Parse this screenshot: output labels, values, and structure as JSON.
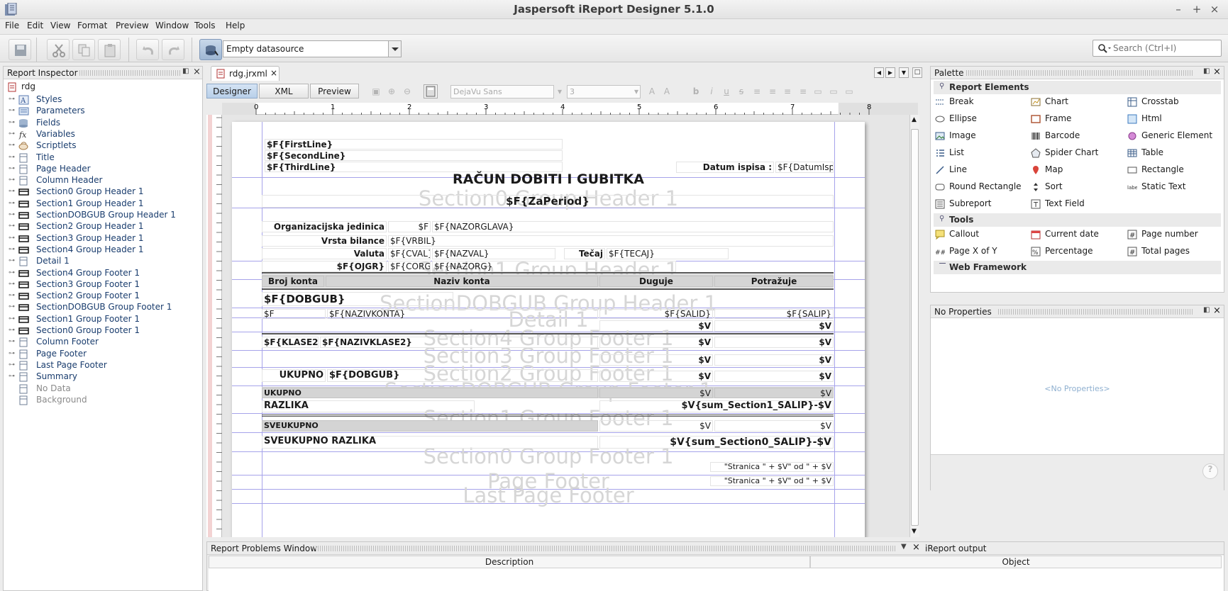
{
  "window": {
    "title": "Jaspersoft iReport Designer 5.1.0"
  },
  "menu": [
    "File",
    "Edit",
    "View",
    "Format",
    "Preview",
    "Window",
    "Tools",
    "Help"
  ],
  "toolbar": {
    "datasource": "Empty datasource",
    "search_placeholder": "Search (Ctrl+I)"
  },
  "inspector": {
    "title": "Report Inspector",
    "root": "rdg",
    "items": [
      {
        "label": "Styles",
        "icon": "styles-icon"
      },
      {
        "label": "Parameters",
        "icon": "parameters-icon"
      },
      {
        "label": "Fields",
        "icon": "fields-icon"
      },
      {
        "label": "Variables",
        "icon": "variables-icon"
      },
      {
        "label": "Scriptlets",
        "icon": "scriptlets-icon"
      },
      {
        "label": "Title",
        "icon": "band-icon"
      },
      {
        "label": "Page Header",
        "icon": "band-icon"
      },
      {
        "label": "Column Header",
        "icon": "band-icon"
      },
      {
        "label": "Section0 Group Header 1",
        "icon": "group-band-icon"
      },
      {
        "label": "Section1 Group Header 1",
        "icon": "group-band-icon"
      },
      {
        "label": "SectionDOBGUB Group Header 1",
        "icon": "group-band-icon"
      },
      {
        "label": "Section2 Group Header 1",
        "icon": "group-band-icon"
      },
      {
        "label": "Section3 Group Header 1",
        "icon": "group-band-icon"
      },
      {
        "label": "Section4 Group Header 1",
        "icon": "group-band-icon"
      },
      {
        "label": "Detail 1",
        "icon": "band-icon"
      },
      {
        "label": "Section4 Group Footer 1",
        "icon": "group-band-icon"
      },
      {
        "label": "Section3 Group Footer 1",
        "icon": "group-band-icon"
      },
      {
        "label": "Section2 Group Footer 1",
        "icon": "group-band-icon"
      },
      {
        "label": "SectionDOBGUB Group Footer 1",
        "icon": "group-band-icon"
      },
      {
        "label": "Section1 Group Footer 1",
        "icon": "group-band-icon"
      },
      {
        "label": "Section0 Group Footer 1",
        "icon": "group-band-icon"
      },
      {
        "label": "Column Footer",
        "icon": "band-icon"
      },
      {
        "label": "Page Footer",
        "icon": "band-icon"
      },
      {
        "label": "Last Page Footer",
        "icon": "band-icon"
      },
      {
        "label": "Summary",
        "icon": "band-icon"
      },
      {
        "label": "No Data",
        "icon": "band-icon",
        "dim": true
      },
      {
        "label": "Background",
        "icon": "band-icon",
        "dim": true
      }
    ]
  },
  "editor": {
    "tab": "rdg.jrxml",
    "modes": [
      "Designer",
      "XML",
      "Preview"
    ],
    "font_name": "DejaVu Sans",
    "font_size": "3",
    "ruler_numbers": [
      "0",
      "1",
      "2",
      "3",
      "4",
      "5",
      "6",
      "7",
      "8"
    ]
  },
  "report": {
    "first_line": "$F{FirstLine}",
    "second_line": "$F{SecondLine}",
    "third_line": "$F{ThirdLine}",
    "datum_label": "Datum ispisa :",
    "datum_value": "$F{DatumIsp}",
    "main_title": "RAČUN DOBITI I GUBITKA",
    "period": "$F{ZaPeriod}",
    "org_label": "Organizacijska jedinica",
    "org_f": "$F",
    "org_value": "$F{NAZORGLAVA}",
    "vrsta_label": "Vrsta bilance",
    "vrsta_value": "$F{VRBIL}",
    "valuta_label": "Valuta",
    "cval": "$F{CVAL}",
    "nazval": "$F{NAZVAL}",
    "tecaj_label": "Tečaj",
    "tecaj_value": "$F{TECAJ}",
    "ojgr": "$F{OJGR}",
    "corg": "$F{CORG}",
    "nazorg": "$F{NAZORG}",
    "col_broj": "Broj konta",
    "col_naziv": "Naziv konta",
    "col_duguje": "Duguje",
    "col_potrazuje": "Potražuje",
    "dobgub": "$F{DOBGUB}",
    "detail_f": "$F",
    "nazivkonta": "$F{NAZIVKONTA}",
    "salid": "$F{SALID}",
    "salip": "$F{SALIP}",
    "v": "$V",
    "klase2": "$F{KLASE2}",
    "nazivklase2": "$F{NAZIVKLASE2}",
    "ukupno": "UKUPNO",
    "razlika": "RAZLIKA",
    "razlika_expr": "$V{sum_Section1_SALIP}-$V",
    "sveukupno": "SVEUKUPNO",
    "sveukupno_razlika": "SVEUKUPNO RAZLIKA",
    "sveukupno_expr": "$V{sum_Section0_SALIP}-$V",
    "page_expr": "\"Stranica \" + $V\" od \" + $V",
    "bands": {
      "s0h": "Section0 Group Header 1",
      "s1h": "Section1 Group Header 1",
      "dobh": "SectionDOBGUB Group Header 1",
      "detail": "Detail 1",
      "s4f": "Section4 Group Footer 1",
      "s3f": "Section3 Group Footer 1",
      "s2f": "Section2 Group Footer 1",
      "dobf": "SectionDOBGUB Group Footer 1",
      "s1f": "Section1 Group Footer 1",
      "s0f": "Section0 Group Footer 1",
      "pf": "Page Footer",
      "lpf": "Last Page Footer"
    }
  },
  "palette": {
    "title": "Palette",
    "cat_report": "Report Elements",
    "report_elements": [
      {
        "label": "Break",
        "icon": "break-icon"
      },
      {
        "label": "Chart",
        "icon": "chart-icon"
      },
      {
        "label": "Crosstab",
        "icon": "crosstab-icon"
      },
      {
        "label": "Ellipse",
        "icon": "ellipse-icon"
      },
      {
        "label": "Frame",
        "icon": "frame-icon"
      },
      {
        "label": "Html",
        "icon": "html-icon"
      },
      {
        "label": "Image",
        "icon": "image-icon"
      },
      {
        "label": "Barcode",
        "icon": "barcode-icon"
      },
      {
        "label": "Generic Element",
        "icon": "generic-element-icon"
      },
      {
        "label": "List",
        "icon": "list-icon"
      },
      {
        "label": "Spider Chart",
        "icon": "spider-chart-icon"
      },
      {
        "label": "Table",
        "icon": "table-icon"
      },
      {
        "label": "Line",
        "icon": "line-icon"
      },
      {
        "label": "Map",
        "icon": "map-icon"
      },
      {
        "label": "Rectangle",
        "icon": "rectangle-icon"
      },
      {
        "label": "Round Rectangle",
        "icon": "round-rectangle-icon"
      },
      {
        "label": "Sort",
        "icon": "sort-icon"
      },
      {
        "label": "Static Text",
        "icon": "static-text-icon"
      },
      {
        "label": "Subreport",
        "icon": "subreport-icon"
      },
      {
        "label": "Text Field",
        "icon": "text-field-icon"
      }
    ],
    "cat_tools": "Tools",
    "tools": [
      {
        "label": "Callout",
        "icon": "callout-icon"
      },
      {
        "label": "Current date",
        "icon": "current-date-icon"
      },
      {
        "label": "Page number",
        "icon": "page-number-icon"
      },
      {
        "label": "Page X of Y",
        "icon": "page-x-of-y-icon"
      },
      {
        "label": "Percentage",
        "icon": "percentage-icon"
      },
      {
        "label": "Total pages",
        "icon": "total-pages-icon"
      }
    ],
    "cat_web": "Web Framework"
  },
  "properties": {
    "title": "No Properties",
    "empty": "<No Properties>"
  },
  "problems": {
    "title": "Report Problems Window",
    "output_tab": "iReport output",
    "col_description": "Description",
    "col_object": "Object"
  }
}
